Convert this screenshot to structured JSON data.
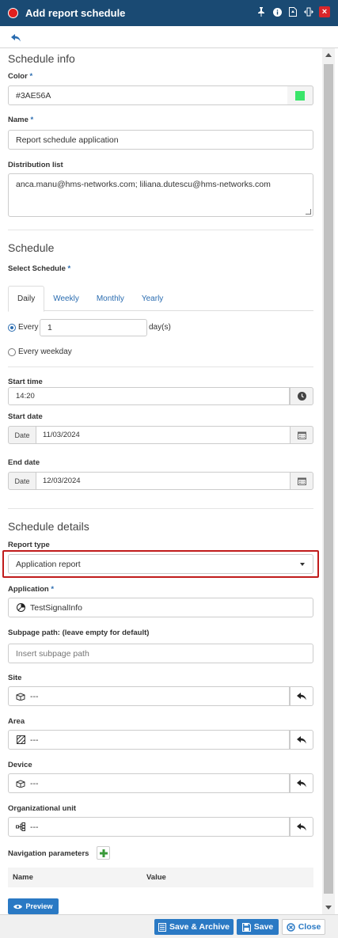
{
  "window": {
    "title": "Add report schedule"
  },
  "colors": {
    "titlebar": "#1a4a73",
    "accent": "#2a79c4",
    "highlight": "#c01b1b",
    "swatch": "#3AE56A"
  },
  "schedule_info": {
    "section_title": "Schedule info",
    "color_label": "Color",
    "color_value": "#3AE56A",
    "name_label": "Name",
    "name_value": "Report schedule application",
    "distribution_label": "Distribution list",
    "distribution_value": "anca.manu@hms-networks.com; liliana.dutescu@hms-networks.com"
  },
  "schedule": {
    "section_title": "Schedule",
    "select_label": "Select Schedule",
    "tabs": [
      {
        "label": "Daily"
      },
      {
        "label": "Weekly"
      },
      {
        "label": "Monthly"
      },
      {
        "label": "Yearly"
      }
    ],
    "every_label": "Every",
    "every_value": "1",
    "every_unit": "day(s)",
    "every_weekday_label": "Every weekday",
    "start_time_label": "Start time",
    "start_time_value": "14:20",
    "start_date_label": "Start date",
    "date_prefix": "Date",
    "start_date_value": "11/03/2024",
    "end_date_label": "End date",
    "end_date_value": "12/03/2024"
  },
  "details": {
    "section_title": "Schedule details",
    "report_type_label": "Report type",
    "report_type_value": "Application report",
    "application_label": "Application",
    "application_value": "TestSignalInfo",
    "subpage_label": "Subpage path: (leave empty for default)",
    "subpage_placeholder": "Insert subpage path",
    "site_label": "Site",
    "site_value": "---",
    "area_label": "Area",
    "area_value": "---",
    "device_label": "Device",
    "device_value": "---",
    "orgunit_label": "Organizational unit",
    "orgunit_value": "---",
    "nav_params_label": "Navigation parameters",
    "table_headers": [
      "Name",
      "Value"
    ],
    "preview_label": "Preview"
  },
  "footer": {
    "save_archive_label": "Save & Archive",
    "save_label": "Save",
    "close_label": "Close"
  }
}
